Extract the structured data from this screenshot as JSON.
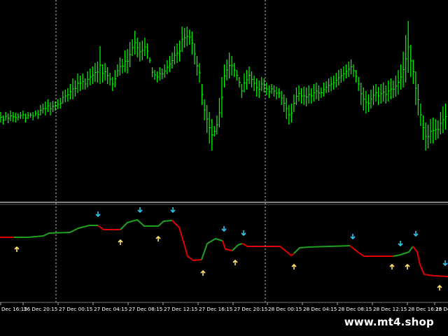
{
  "time_labels": [
    "Dec 16:15",
    "26 Dec 20:15",
    "27 Dec 00:15",
    "27 Dec 04:15",
    "27 Dec 08:15",
    "27 Dec 12:15",
    "27 Dec 16:15",
    "27 Dec 20:15",
    "28 Dec 00:15",
    "28 Dec 04:15",
    "28 Dec 08:15",
    "28 Dec 12:15",
    "28 Dec 16:15",
    "28 Dec"
  ],
  "watermark": "www.mt4.shop",
  "colors": {
    "background": "#000000",
    "bars": "#00ff00",
    "indicator_up": "#1fa11f",
    "indicator_down": "#e00000",
    "sell_arrow": "#2ec7ee",
    "buy_arrow": "#ffe36a",
    "separator": "#aaaaaa",
    "axis_text": "#ffffff"
  },
  "price_pane": {
    "series": [
      [
        160,
        175
      ],
      [
        165,
        178
      ],
      [
        160,
        172
      ],
      [
        162,
        176
      ],
      [
        158,
        173
      ],
      [
        160,
        174
      ],
      [
        161,
        175
      ],
      [
        162,
        172
      ],
      [
        160,
        170
      ],
      [
        158,
        170
      ],
      [
        162,
        175
      ],
      [
        160,
        170
      ],
      [
        161,
        168
      ],
      [
        160,
        172
      ],
      [
        158,
        166
      ],
      [
        157,
        170
      ],
      [
        150,
        165
      ],
      [
        148,
        162
      ],
      [
        145,
        165
      ],
      [
        142,
        160
      ],
      [
        146,
        165
      ],
      [
        144,
        160
      ],
      [
        145,
        158
      ],
      [
        142,
        156
      ],
      [
        140,
        155
      ],
      [
        130,
        148
      ],
      [
        128,
        146
      ],
      [
        126,
        145
      ],
      [
        120,
        142
      ],
      [
        112,
        142
      ],
      [
        115,
        138
      ],
      [
        105,
        133
      ],
      [
        108,
        130
      ],
      [
        105,
        128
      ],
      [
        112,
        128
      ],
      [
        102,
        125
      ],
      [
        98,
        122
      ],
      [
        95,
        120
      ],
      [
        90,
        117
      ],
      [
        88,
        118
      ],
      [
        66,
        120
      ],
      [
        92,
        118
      ],
      [
        90,
        115
      ],
      [
        96,
        120
      ],
      [
        104,
        122
      ],
      [
        110,
        130
      ],
      [
        100,
        125
      ],
      [
        92,
        110
      ],
      [
        82,
        108
      ],
      [
        84,
        105
      ],
      [
        72,
        103
      ],
      [
        70,
        105
      ],
      [
        60,
        96
      ],
      [
        56,
        80
      ],
      [
        44,
        78
      ],
      [
        54,
        82
      ],
      [
        60,
        88
      ],
      [
        58,
        86
      ],
      [
        54,
        80
      ],
      [
        62,
        84
      ],
      [
        82,
        90
      ],
      [
        96,
        110
      ],
      [
        100,
        114
      ],
      [
        102,
        118
      ],
      [
        96,
        115
      ],
      [
        98,
        113
      ],
      [
        92,
        111
      ],
      [
        86,
        106
      ],
      [
        80,
        103
      ],
      [
        75,
        98
      ],
      [
        66,
        92
      ],
      [
        62,
        90
      ],
      [
        58,
        88
      ],
      [
        38,
        74
      ],
      [
        40,
        68
      ],
      [
        38,
        66
      ],
      [
        42,
        64
      ],
      [
        45,
        78
      ],
      [
        62,
        92
      ],
      [
        80,
        108
      ],
      [
        90,
        118
      ],
      [
        120,
        150
      ],
      [
        142,
        172
      ],
      [
        150,
        190
      ],
      [
        160,
        205
      ],
      [
        170,
        215
      ],
      [
        180,
        195
      ],
      [
        165,
        192
      ],
      [
        140,
        182
      ],
      [
        110,
        168
      ],
      [
        92,
        125
      ],
      [
        85,
        115
      ],
      [
        75,
        112
      ],
      [
        80,
        108
      ],
      [
        90,
        110
      ],
      [
        100,
        115
      ],
      [
        110,
        125
      ],
      [
        120,
        140
      ],
      [
        105,
        132
      ],
      [
        100,
        128
      ],
      [
        95,
        120
      ],
      [
        102,
        125
      ],
      [
        108,
        130
      ],
      [
        112,
        138
      ],
      [
        115,
        140
      ],
      [
        110,
        130
      ],
      [
        112,
        132
      ],
      [
        118,
        136
      ],
      [
        122,
        140
      ],
      [
        120,
        134
      ],
      [
        122,
        138
      ],
      [
        124,
        142
      ],
      [
        126,
        140
      ],
      [
        130,
        150
      ],
      [
        135,
        160
      ],
      [
        140,
        170
      ],
      [
        150,
        178
      ],
      [
        148,
        175
      ],
      [
        135,
        160
      ],
      [
        125,
        150
      ],
      [
        122,
        145
      ],
      [
        126,
        148
      ],
      [
        124,
        150
      ],
      [
        125,
        152
      ],
      [
        122,
        148
      ],
      [
        126,
        148
      ],
      [
        120,
        145
      ],
      [
        118,
        142
      ],
      [
        122,
        144
      ],
      [
        125,
        140
      ],
      [
        118,
        138
      ],
      [
        116,
        133
      ],
      [
        112,
        132
      ],
      [
        110,
        130
      ],
      [
        108,
        128
      ],
      [
        104,
        125
      ],
      [
        100,
        122
      ],
      [
        98,
        118
      ],
      [
        95,
        116
      ],
      [
        92,
        112
      ],
      [
        88,
        110
      ],
      [
        85,
        106
      ],
      [
        92,
        110
      ],
      [
        100,
        118
      ],
      [
        110,
        130
      ],
      [
        118,
        150
      ],
      [
        125,
        158
      ],
      [
        130,
        162
      ],
      [
        135,
        160
      ],
      [
        128,
        155
      ],
      [
        122,
        150
      ],
      [
        120,
        145
      ],
      [
        124,
        150
      ],
      [
        120,
        148
      ],
      [
        118,
        145
      ],
      [
        122,
        148
      ],
      [
        115,
        145
      ],
      [
        112,
        142
      ],
      [
        115,
        140
      ],
      [
        108,
        138
      ],
      [
        100,
        135
      ],
      [
        92,
        128
      ],
      [
        74,
        125
      ],
      [
        50,
        118
      ],
      [
        30,
        104
      ],
      [
        64,
        110
      ],
      [
        85,
        120
      ],
      [
        102,
        150
      ],
      [
        120,
        165
      ],
      [
        148,
        180
      ],
      [
        165,
        200
      ],
      [
        175,
        215
      ],
      [
        178,
        212
      ],
      [
        170,
        205
      ],
      [
        168,
        205
      ],
      [
        170,
        200
      ],
      [
        172,
        198
      ],
      [
        160,
        192
      ],
      [
        152,
        190
      ],
      [
        148,
        185
      ]
    ]
  },
  "indicator_pane": {
    "segments": [
      {
        "color": "down",
        "points": [
          [
            0,
            339
          ],
          [
            20,
            339
          ]
        ]
      },
      {
        "color": "up",
        "points": [
          [
            20,
            339
          ],
          [
            40,
            339
          ],
          [
            62,
            337
          ],
          [
            70,
            333
          ],
          [
            100,
            332
          ],
          [
            112,
            326
          ],
          [
            128,
            322
          ],
          [
            140,
            322
          ]
        ]
      },
      {
        "color": "down",
        "points": [
          [
            140,
            322
          ],
          [
            148,
            328
          ],
          [
            172,
            328
          ]
        ]
      },
      {
        "color": "up",
        "points": [
          [
            172,
            328
          ],
          [
            182,
            318
          ],
          [
            196,
            314
          ],
          [
            206,
            323
          ],
          [
            226,
            323
          ],
          [
            234,
            316
          ],
          [
            246,
            315
          ]
        ]
      },
      {
        "color": "down",
        "points": [
          [
            246,
            315
          ],
          [
            256,
            325
          ],
          [
            262,
            345
          ],
          [
            268,
            366
          ],
          [
            276,
            372
          ],
          [
            288,
            371
          ]
        ]
      },
      {
        "color": "up",
        "points": [
          [
            288,
            371
          ],
          [
            296,
            348
          ],
          [
            308,
            341
          ],
          [
            318,
            344
          ]
        ]
      },
      {
        "color": "down",
        "points": [
          [
            318,
            344
          ],
          [
            322,
            356
          ],
          [
            332,
            358
          ]
        ]
      },
      {
        "color": "up",
        "points": [
          [
            332,
            358
          ],
          [
            340,
            350
          ],
          [
            346,
            348
          ]
        ]
      },
      {
        "color": "down",
        "points": [
          [
            346,
            348
          ],
          [
            354,
            352
          ],
          [
            400,
            352
          ],
          [
            410,
            360
          ],
          [
            416,
            365
          ],
          [
            420,
            362
          ]
        ]
      },
      {
        "color": "up",
        "points": [
          [
            420,
            362
          ],
          [
            428,
            354
          ],
          [
            440,
            353
          ],
          [
            500,
            351
          ]
        ]
      },
      {
        "color": "down",
        "points": [
          [
            500,
            351
          ],
          [
            506,
            356
          ],
          [
            514,
            362
          ],
          [
            520,
            366
          ],
          [
            562,
            366
          ]
        ]
      },
      {
        "color": "up",
        "points": [
          [
            562,
            366
          ],
          [
            572,
            364
          ],
          [
            584,
            360
          ],
          [
            590,
            352
          ]
        ]
      },
      {
        "color": "down",
        "points": [
          [
            590,
            352
          ],
          [
            596,
            360
          ],
          [
            600,
            378
          ],
          [
            606,
            392
          ],
          [
            620,
            394
          ],
          [
            640,
            395
          ]
        ]
      }
    ],
    "sell_arrows": [
      [
        140,
        306
      ],
      [
        200,
        300
      ],
      [
        247,
        300
      ],
      [
        320,
        327
      ],
      [
        348,
        333
      ],
      [
        504,
        338
      ],
      [
        572,
        348
      ],
      [
        594,
        334
      ],
      [
        636,
        376
      ]
    ],
    "buy_arrows": [
      [
        24,
        356
      ],
      [
        172,
        346
      ],
      [
        226,
        341
      ],
      [
        290,
        390
      ],
      [
        336,
        375
      ],
      [
        420,
        381
      ],
      [
        560,
        381
      ],
      [
        582,
        381
      ],
      [
        628,
        411
      ]
    ]
  }
}
